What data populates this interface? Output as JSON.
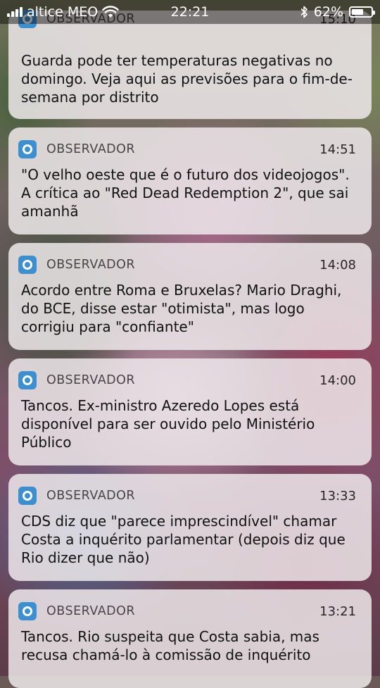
{
  "status_bar": {
    "carrier": "altice MEO",
    "time": "22:21",
    "battery_percent": "62%",
    "battery_level": 0.62,
    "icons": [
      "signal-icon",
      "wifi-icon",
      "bluetooth-icon",
      "battery-icon"
    ]
  },
  "notifications": [
    {
      "app": "OBSERVADOR",
      "time": "15:10",
      "message": "Guarda pode ter temperaturas negativas no domingo. Veja aqui as previsões para o fim-de-semana por distrito"
    },
    {
      "app": "OBSERVADOR",
      "time": "14:51",
      "message": "\"O velho oeste que é o futuro dos videojogos\". A crítica ao \"Red Dead Redemption 2\", que sai amanhã"
    },
    {
      "app": "OBSERVADOR",
      "time": "14:08",
      "message": "Acordo entre Roma e Bruxelas? Mario Draghi, do BCE, disse estar \"otimista\", mas logo corrigiu para \"confiante\""
    },
    {
      "app": "OBSERVADOR",
      "time": "14:00",
      "message": "Tancos. Ex-ministro Azeredo Lopes está disponível para ser ouvido pelo Ministério Público"
    },
    {
      "app": "OBSERVADOR",
      "time": "13:33",
      "message": "CDS diz que \"parece imprescindível\" chamar Costa a inquérito parlamentar (depois diz que Rio dizer que não)"
    },
    {
      "app": "OBSERVADOR",
      "time": "13:21",
      "message": "Tancos. Rio suspeita que Costa sabia, mas recusa chamá-lo à comissão de inquérito"
    }
  ],
  "colors": {
    "app_icon": "#3d8fd0",
    "card_background": "#eee8ea"
  }
}
